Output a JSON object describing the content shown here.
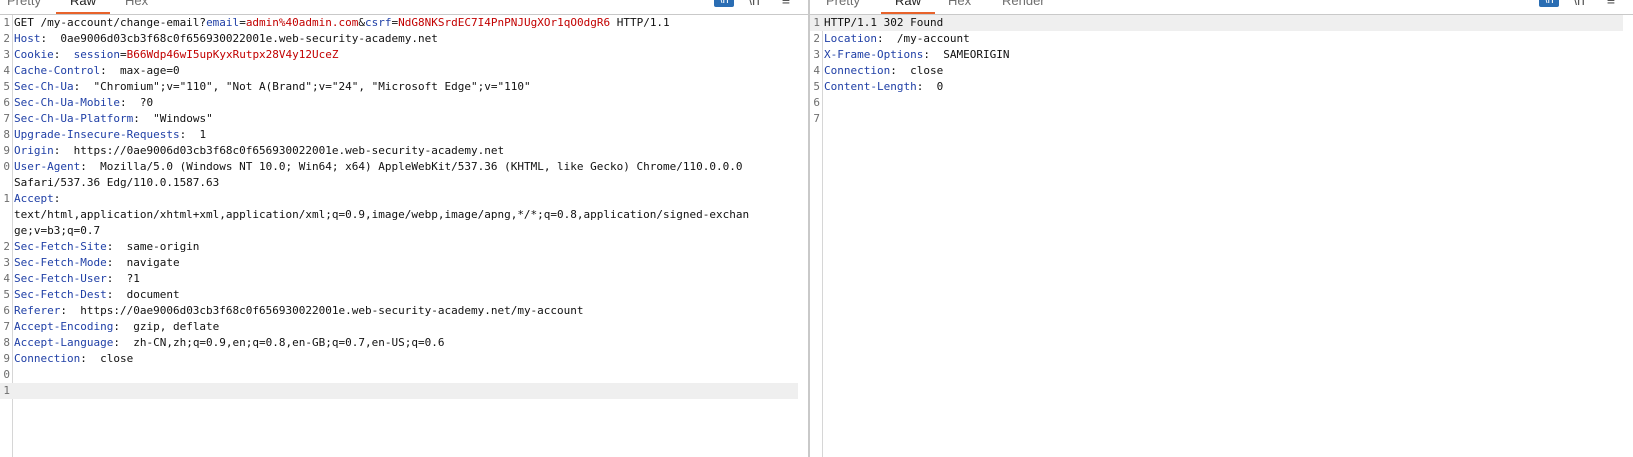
{
  "request": {
    "tabs": [
      "Pretty",
      "Raw",
      "Hex"
    ],
    "active_tab": "Raw",
    "toolbar": {
      "badge": "\\n",
      "wrap_icon": "\\n",
      "menu_icon": "≡"
    },
    "lines": [
      {
        "n": "1",
        "segs": [
          {
            "t": "GET /my-account/change-email?",
            "c": "val"
          },
          {
            "t": "email",
            "c": "blu"
          },
          {
            "t": "=",
            "c": "val"
          },
          {
            "t": "admin%40admin.com",
            "c": "red"
          },
          {
            "t": "&",
            "c": "val"
          },
          {
            "t": "csrf",
            "c": "blu"
          },
          {
            "t": "=",
            "c": "val"
          },
          {
            "t": "NdG8NKSrdEC7I4PnPNJUgXOr1qO0dgR6",
            "c": "red"
          },
          {
            "t": " HTTP/1.1",
            "c": "val"
          }
        ]
      },
      {
        "n": "2",
        "segs": [
          {
            "t": "Host",
            "c": "hdr"
          },
          {
            "t": ":  0ae9006d03cb3f68c0f656930022001e.web-security-academy.net",
            "c": "val"
          }
        ]
      },
      {
        "n": "3",
        "segs": [
          {
            "t": "Cookie",
            "c": "hdr"
          },
          {
            "t": ":  ",
            "c": "val"
          },
          {
            "t": "session",
            "c": "blu"
          },
          {
            "t": "=",
            "c": "val"
          },
          {
            "t": "B66Wdp46wI5upKyxRutpx28V4y12UceZ",
            "c": "red"
          }
        ]
      },
      {
        "n": "4",
        "segs": [
          {
            "t": "Cache-Control",
            "c": "hdr"
          },
          {
            "t": ":  max-age=0",
            "c": "val"
          }
        ]
      },
      {
        "n": "5",
        "segs": [
          {
            "t": "Sec-Ch-Ua",
            "c": "hdr"
          },
          {
            "t": ":  \"Chromium\";v=\"110\", \"Not A(Brand\";v=\"24\", \"Microsoft Edge\";v=\"110\"",
            "c": "val"
          }
        ]
      },
      {
        "n": "6",
        "segs": [
          {
            "t": "Sec-Ch-Ua-Mobile",
            "c": "hdr"
          },
          {
            "t": ":  ?0",
            "c": "val"
          }
        ]
      },
      {
        "n": "7",
        "segs": [
          {
            "t": "Sec-Ch-Ua-Platform",
            "c": "hdr"
          },
          {
            "t": ":  \"Windows\"",
            "c": "val"
          }
        ]
      },
      {
        "n": "8",
        "segs": [
          {
            "t": "Upgrade-Insecure-Requests",
            "c": "hdr"
          },
          {
            "t": ":  1",
            "c": "val"
          }
        ]
      },
      {
        "n": "9",
        "segs": [
          {
            "t": "Origin",
            "c": "hdr"
          },
          {
            "t": ":  https://0ae9006d03cb3f68c0f656930022001e.web-security-academy.net",
            "c": "val"
          }
        ]
      },
      {
        "n": "0",
        "segs": [
          {
            "t": "User-Agent",
            "c": "hdr"
          },
          {
            "t": ":  Mozilla/5.0 (Windows NT 10.0; Win64; x64) AppleWebKit/537.36 (KHTML, like Gecko) Chrome/110.0.0.0",
            "c": "val"
          }
        ]
      },
      {
        "n": "",
        "segs": [
          {
            "t": "Safari/537.36 Edg/110.0.1587.63",
            "c": "val"
          }
        ]
      },
      {
        "n": "1",
        "segs": [
          {
            "t": "Accept",
            "c": "hdr"
          },
          {
            "t": ":",
            "c": "val"
          }
        ]
      },
      {
        "n": "",
        "segs": [
          {
            "t": "text/html,application/xhtml+xml,application/xml;q=0.9,image/webp,image/apng,*/*;q=0.8,application/signed-exchan",
            "c": "val"
          }
        ]
      },
      {
        "n": "",
        "segs": [
          {
            "t": "ge;v=b3;q=0.7",
            "c": "val"
          }
        ]
      },
      {
        "n": "2",
        "segs": [
          {
            "t": "Sec-Fetch-Site",
            "c": "hdr"
          },
          {
            "t": ":  same-origin",
            "c": "val"
          }
        ]
      },
      {
        "n": "3",
        "segs": [
          {
            "t": "Sec-Fetch-Mode",
            "c": "hdr"
          },
          {
            "t": ":  navigate",
            "c": "val"
          }
        ]
      },
      {
        "n": "4",
        "segs": [
          {
            "t": "Sec-Fetch-User",
            "c": "hdr"
          },
          {
            "t": ":  ?1",
            "c": "val"
          }
        ]
      },
      {
        "n": "5",
        "segs": [
          {
            "t": "Sec-Fetch-Dest",
            "c": "hdr"
          },
          {
            "t": ":  document",
            "c": "val"
          }
        ]
      },
      {
        "n": "6",
        "segs": [
          {
            "t": "Referer",
            "c": "hdr"
          },
          {
            "t": ":  https://0ae9006d03cb3f68c0f656930022001e.web-security-academy.net/my-account",
            "c": "val"
          }
        ]
      },
      {
        "n": "7",
        "segs": [
          {
            "t": "Accept-Encoding",
            "c": "hdr"
          },
          {
            "t": ":  gzip, deflate",
            "c": "val"
          }
        ]
      },
      {
        "n": "8",
        "segs": [
          {
            "t": "Accept-Language",
            "c": "hdr"
          },
          {
            "t": ":  zh-CN,zh;q=0.9,en;q=0.8,en-GB;q=0.7,en-US;q=0.6",
            "c": "val"
          }
        ]
      },
      {
        "n": "9",
        "segs": [
          {
            "t": "Connection",
            "c": "hdr"
          },
          {
            "t": ":  close",
            "c": "val"
          }
        ]
      },
      {
        "n": "0",
        "segs": []
      },
      {
        "n": "1",
        "segs": [],
        "highlight": true
      }
    ]
  },
  "response": {
    "tabs": [
      "Pretty",
      "Raw",
      "Hex",
      "Render"
    ],
    "active_tab": "Raw",
    "toolbar": {
      "badge": "\\n",
      "wrap_icon": "\\n",
      "menu_icon": "≡"
    },
    "lines": [
      {
        "n": "1",
        "segs": [
          {
            "t": "HTTP/1.1 302 Found",
            "c": "val"
          }
        ],
        "highlight": true
      },
      {
        "n": "2",
        "segs": [
          {
            "t": "Location",
            "c": "hdr"
          },
          {
            "t": ":  /my-account",
            "c": "val"
          }
        ]
      },
      {
        "n": "3",
        "segs": [
          {
            "t": "X-Frame-Options",
            "c": "hdr"
          },
          {
            "t": ":  SAMEORIGIN",
            "c": "val"
          }
        ]
      },
      {
        "n": "4",
        "segs": [
          {
            "t": "Connection",
            "c": "hdr"
          },
          {
            "t": ":  close",
            "c": "val"
          }
        ]
      },
      {
        "n": "5",
        "segs": [
          {
            "t": "Content-Length",
            "c": "hdr"
          },
          {
            "t": ":  0",
            "c": "val"
          }
        ]
      },
      {
        "n": "6",
        "segs": []
      },
      {
        "n": "7",
        "segs": []
      }
    ]
  }
}
